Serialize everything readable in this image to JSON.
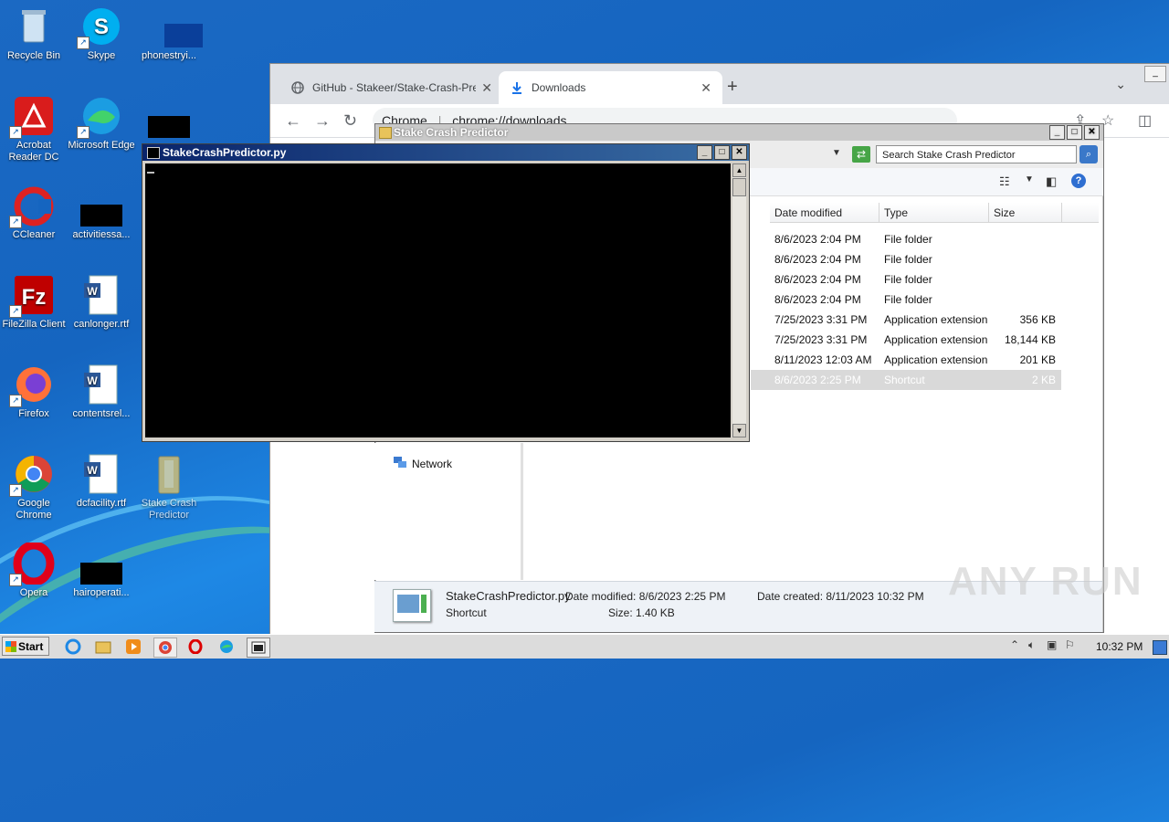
{
  "desktop": {
    "icons": [
      {
        "label": "Recycle Bin"
      },
      {
        "label": "Skype"
      },
      {
        "label": "phonestryi..."
      },
      {
        "label": "Acrobat Reader DC"
      },
      {
        "label": "Microsoft Edge"
      },
      {
        "label": "CCleaner"
      },
      {
        "label": "activitiessa..."
      },
      {
        "label": "FileZilla Client"
      },
      {
        "label": "canlonger.rtf"
      },
      {
        "label": "Firefox"
      },
      {
        "label": "contentsrel..."
      },
      {
        "label": "Google Chrome"
      },
      {
        "label": "dcfacility.rtf"
      },
      {
        "label": "Stake Crash Predictor"
      },
      {
        "label": "Opera"
      },
      {
        "label": "hairoperati..."
      }
    ]
  },
  "chrome": {
    "tabs": [
      {
        "title": "GitHub - Stakeer/Stake-Crash-Predic"
      },
      {
        "title": "Downloads"
      }
    ],
    "omnibox": {
      "chip": "Chrome",
      "url": "chrome://downloads"
    }
  },
  "explorer": {
    "title": "Stake Crash Predictor",
    "search_placeholder": "Search Stake Crash Predictor",
    "columns": [
      "Date modified",
      "Type",
      "Size"
    ],
    "rows": [
      {
        "date": "8/6/2023 2:04 PM",
        "type": "File folder",
        "size": ""
      },
      {
        "date": "8/6/2023 2:04 PM",
        "type": "File folder",
        "size": ""
      },
      {
        "date": "8/6/2023 2:04 PM",
        "type": "File folder",
        "size": ""
      },
      {
        "date": "8/6/2023 2:04 PM",
        "type": "File folder",
        "size": ""
      },
      {
        "date": "7/25/2023 3:31 PM",
        "type": "Application extension",
        "size": "356 KB"
      },
      {
        "date": "7/25/2023 3:31 PM",
        "type": "Application extension",
        "size": "18,144 KB"
      },
      {
        "date": "8/11/2023 12:03 AM",
        "type": "Application extension",
        "size": "201 KB"
      },
      {
        "date": "8/6/2023 2:25 PM",
        "type": "Shortcut",
        "size": "2 KB"
      }
    ],
    "nav": {
      "network": "Network"
    },
    "details": {
      "name": "StakeCrashPredictor.py",
      "kind": "Shortcut",
      "date_modified": "Date modified: 8/6/2023 2:25 PM",
      "size": "Size: 1.40 KB",
      "date_created": "Date created: 8/11/2023 10:32 PM"
    }
  },
  "console": {
    "title": "StakeCrashPredictor.py"
  },
  "taskbar": {
    "start_label": "Start",
    "clock": "10:32 PM"
  },
  "watermark": "ANY RUN"
}
